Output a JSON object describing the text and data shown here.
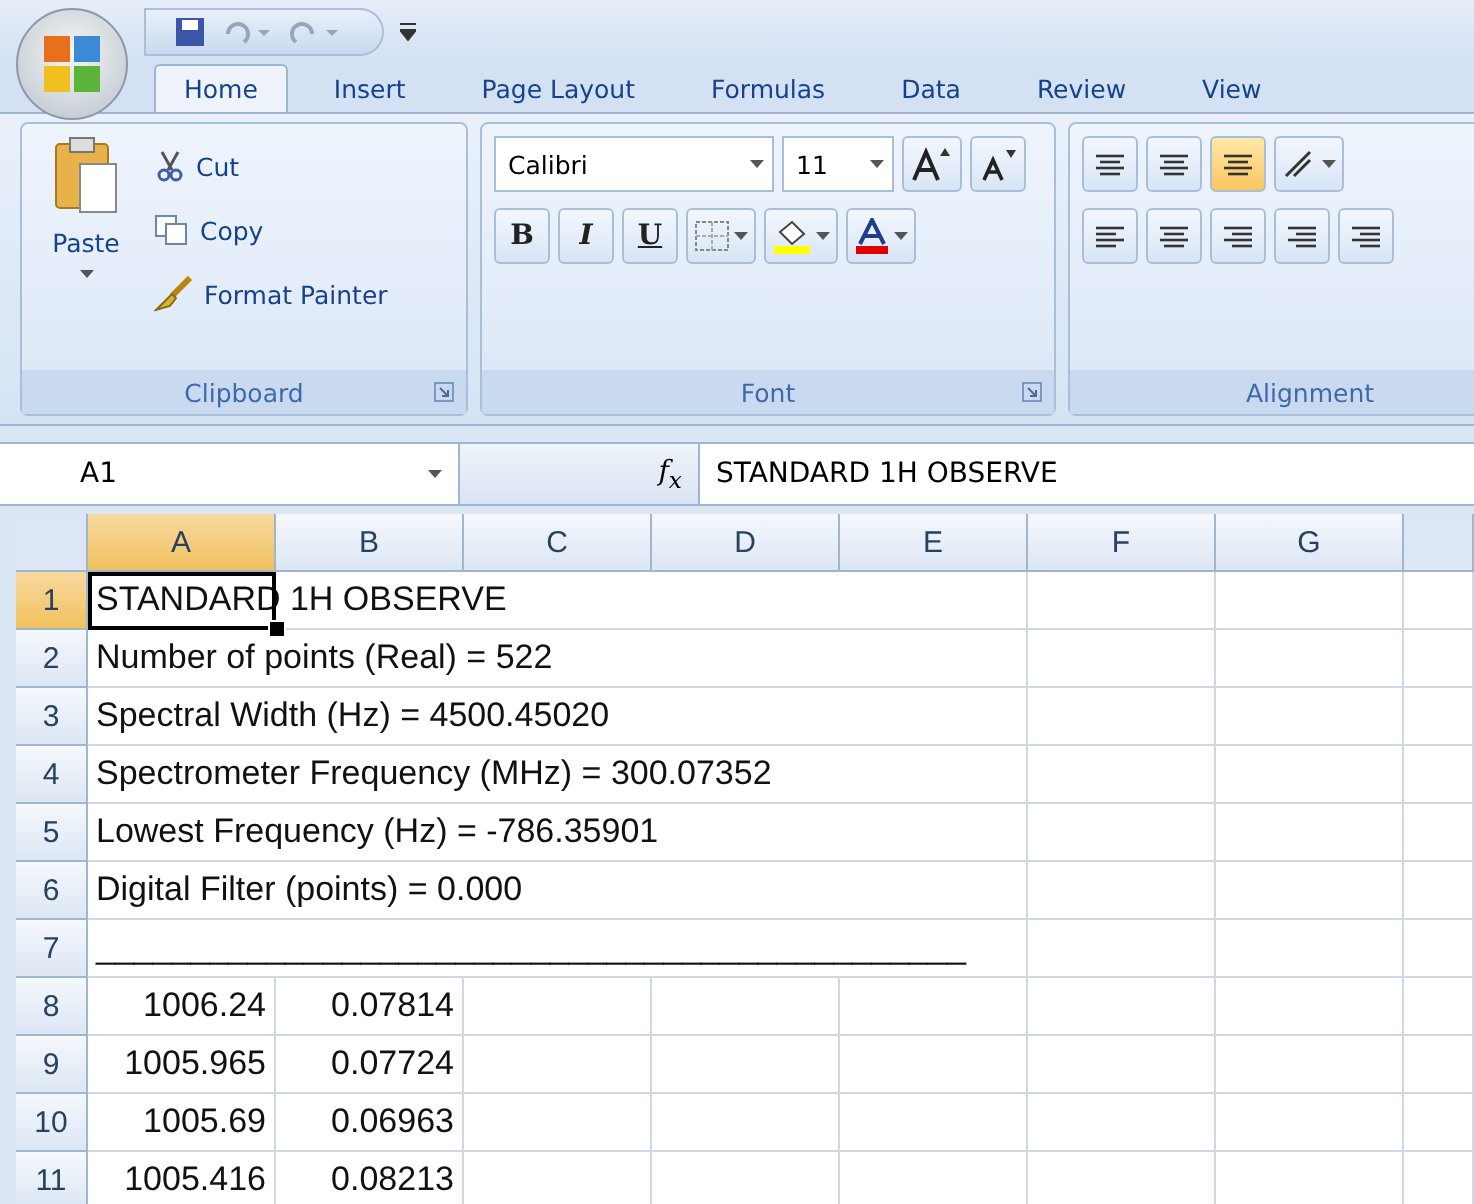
{
  "tabs": [
    {
      "label": "Home",
      "selected": true
    },
    {
      "label": "Insert",
      "selected": false
    },
    {
      "label": "Page Layout",
      "selected": false
    },
    {
      "label": "Formulas",
      "selected": false
    },
    {
      "label": "Data",
      "selected": false
    },
    {
      "label": "Review",
      "selected": false
    },
    {
      "label": "View",
      "selected": false
    }
  ],
  "ribbon": {
    "groups": [
      {
        "kind": "clipboard",
        "label": "Clipboard",
        "paste": "Paste",
        "commands": [
          "Cut",
          "Copy",
          "Format Painter"
        ]
      },
      {
        "kind": "font",
        "label": "Font",
        "font_name": "Calibri",
        "font_size": "11",
        "bold": "B",
        "italic": "I",
        "underline": "U"
      },
      {
        "kind": "alignment",
        "label": "Alignment"
      }
    ]
  },
  "formula_bar": {
    "name_box": "A1",
    "function_label": "f$_{x}$",
    "value": "STANDARD 1H OBSERVE"
  },
  "sheet": {
    "columns": [
      {
        "label": "A",
        "selected": true
      },
      {
        "label": "B",
        "selected": false
      },
      {
        "label": "C",
        "selected": false
      },
      {
        "label": "D",
        "selected": false
      },
      {
        "label": "E",
        "selected": false
      },
      {
        "label": "F",
        "selected": false
      },
      {
        "label": "G",
        "selected": false
      }
    ],
    "rows": [
      {
        "number": "1",
        "selected": true,
        "kind": "text",
        "text": "STANDARD 1H OBSERVE"
      },
      {
        "number": "2",
        "selected": false,
        "kind": "text",
        "text": "Number of points (Real) = 522"
      },
      {
        "number": "3",
        "selected": false,
        "kind": "text",
        "text": "Spectral Width (Hz) = 4500.45020"
      },
      {
        "number": "4",
        "selected": false,
        "kind": "text",
        "text": "Spectrometer Frequency (MHz) = 300.07352"
      },
      {
        "number": "5",
        "selected": false,
        "kind": "text",
        "text": "Lowest Frequency (Hz) = -786.35901"
      },
      {
        "number": "6",
        "selected": false,
        "kind": "text",
        "text": "Digital Filter (points) = 0.000"
      },
      {
        "number": "7",
        "selected": false,
        "kind": "text",
        "text": "______________________________________________"
      },
      {
        "number": "8",
        "selected": false,
        "kind": "values",
        "cells": [
          "1006.24",
          "0.07814"
        ]
      },
      {
        "number": "9",
        "selected": false,
        "kind": "values",
        "cells": [
          "1005.965",
          "0.07724"
        ]
      },
      {
        "number": "10",
        "selected": false,
        "kind": "values",
        "cells": [
          "1005.69",
          "0.06963"
        ]
      },
      {
        "number": "11",
        "selected": false,
        "kind": "values",
        "cells": [
          "1005.416",
          "0.08213"
        ]
      }
    ]
  }
}
